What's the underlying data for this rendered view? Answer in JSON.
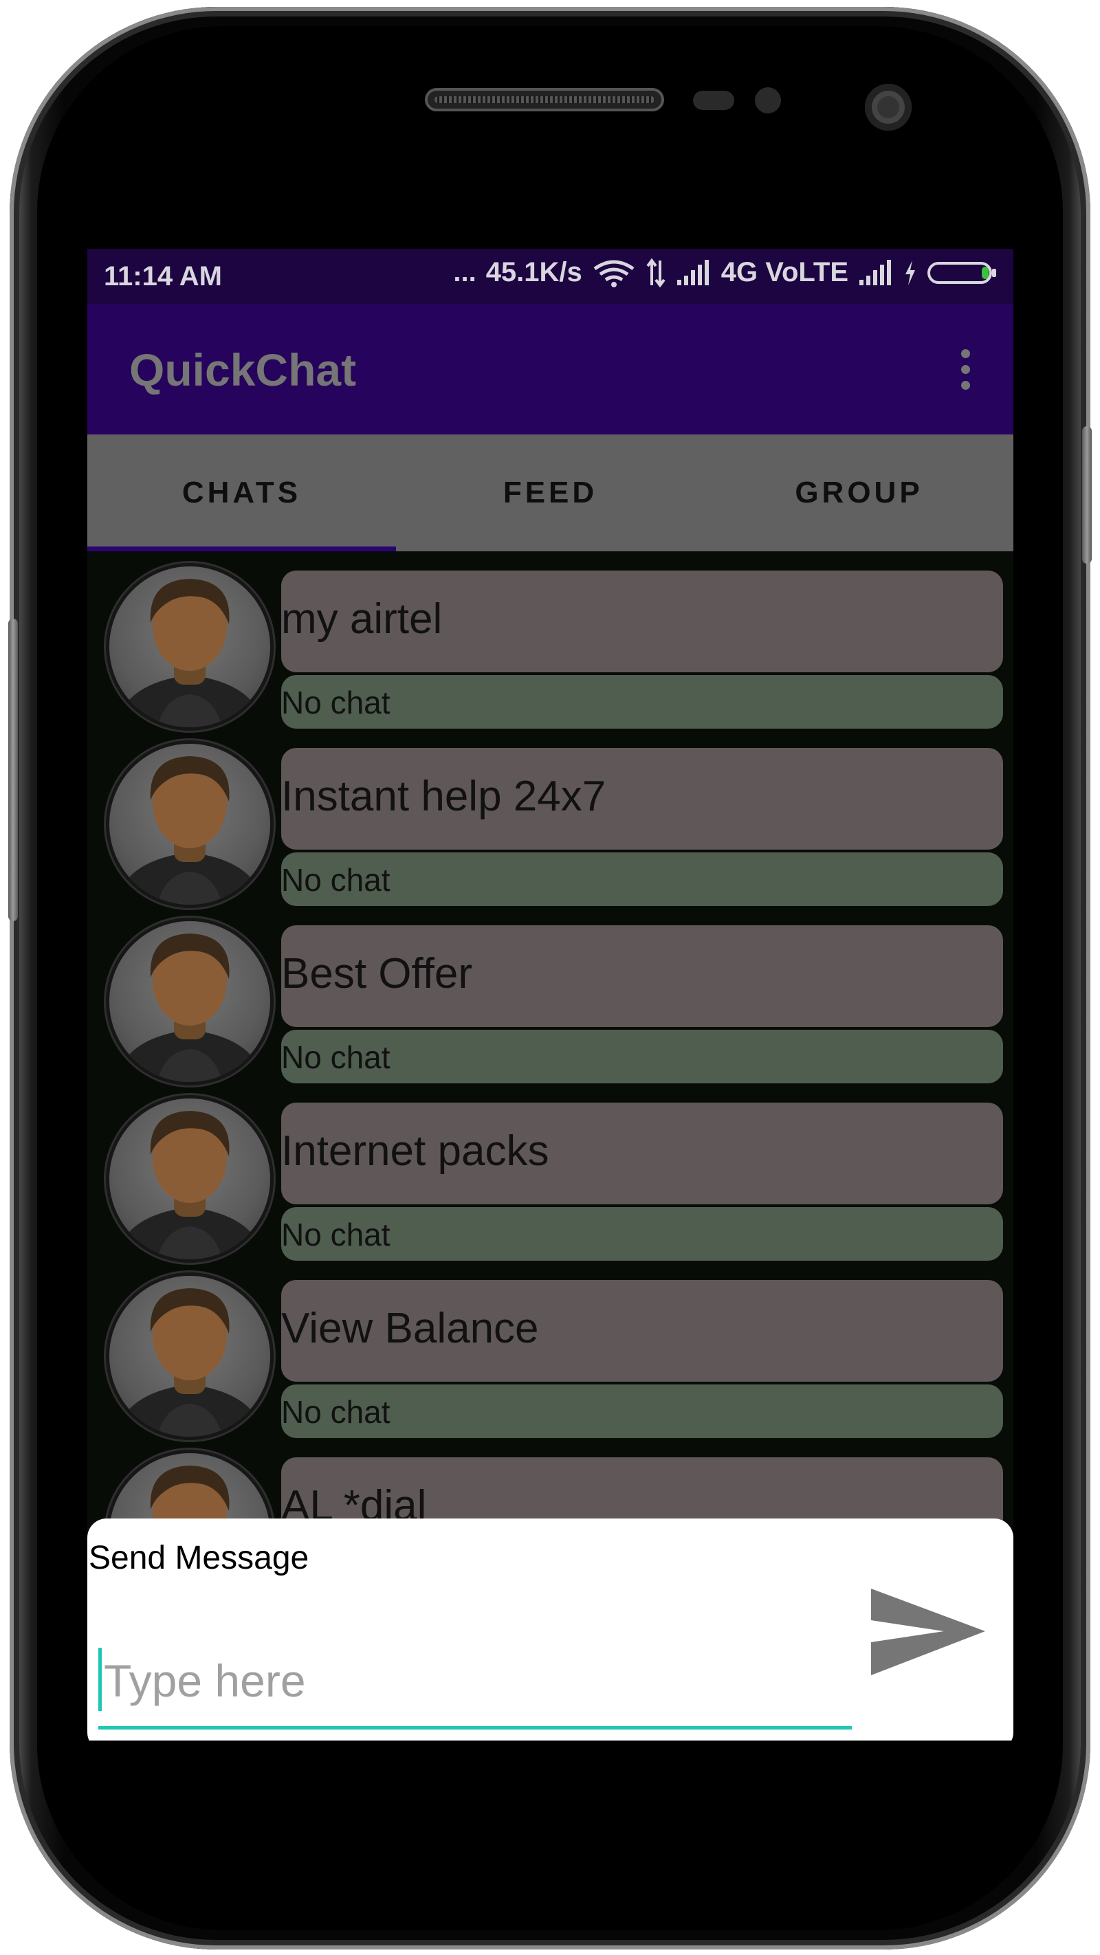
{
  "status_bar": {
    "time": "11:14 AM",
    "dots": "...",
    "speed": "45.1K/s",
    "network": "4G VoLTE",
    "icons": [
      "wifi-icon",
      "data-transfer-icon",
      "signal-icon",
      "signal-icon-2",
      "charging-icon",
      "battery-icon"
    ]
  },
  "app_bar": {
    "title": "QuickChat",
    "menu_icon": "more-vert-icon"
  },
  "tabs": [
    {
      "label": "CHATS",
      "selected": true
    },
    {
      "label": "FEED",
      "selected": false
    },
    {
      "label": "GROUP",
      "selected": false
    }
  ],
  "chats": [
    {
      "name": "my airtel",
      "last_message": "No chat"
    },
    {
      "name": "Instant help 24x7",
      "last_message": "No chat"
    },
    {
      "name": "Best Offer",
      "last_message": "No chat"
    },
    {
      "name": "Internet packs",
      "last_message": "No chat"
    },
    {
      "name": "View Balance",
      "last_message": "No chat"
    },
    {
      "name": "AL *dial",
      "last_message": ""
    }
  ],
  "send_panel": {
    "label": "Send Message",
    "placeholder": "Type here",
    "value": "",
    "send_icon": "send-icon"
  },
  "colors": {
    "status_bar": "#1c0540",
    "app_bar": "#26035c",
    "tab_bar": "#616161",
    "tab_indicator": "#2a0572",
    "chat_name_bg": "#605858",
    "chat_msg_bg": "#4f5e4f",
    "input_accent": "#1fc7b2"
  }
}
